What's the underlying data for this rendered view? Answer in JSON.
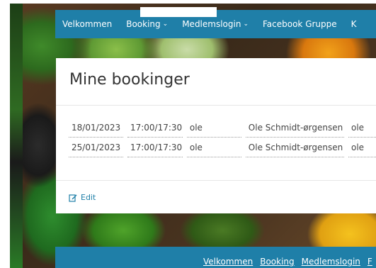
{
  "nav": {
    "items": [
      {
        "label": "Velkommen",
        "has_dropdown": false
      },
      {
        "label": "Booking",
        "has_dropdown": true
      },
      {
        "label": "Medlemslogin",
        "has_dropdown": true
      },
      {
        "label": "Facebook Gruppe",
        "has_dropdown": false
      },
      {
        "label": "K",
        "has_dropdown": false
      }
    ]
  },
  "card": {
    "title": "Mine bookinger",
    "rows": [
      {
        "date": "18/01/2023",
        "time": "17:00/17:30",
        "user": "ole",
        "name": "Ole Schmidt-ørgensen",
        "extra": "ole"
      },
      {
        "date": "25/01/2023",
        "time": "17:00/17:30",
        "user": "ole",
        "name": "Ole Schmidt-ørgensen",
        "extra": "ole"
      }
    ],
    "edit_label": "Edit"
  },
  "footer": {
    "links": [
      "Velkommen",
      "Booking",
      "Medlemslogin",
      "F"
    ]
  },
  "colors": {
    "accent": "#1f7fa8",
    "card_bg": "#ffffff",
    "text": "#444444"
  },
  "icons": {
    "edit": "edit-icon",
    "dropdown": "chevron-down-icon"
  }
}
